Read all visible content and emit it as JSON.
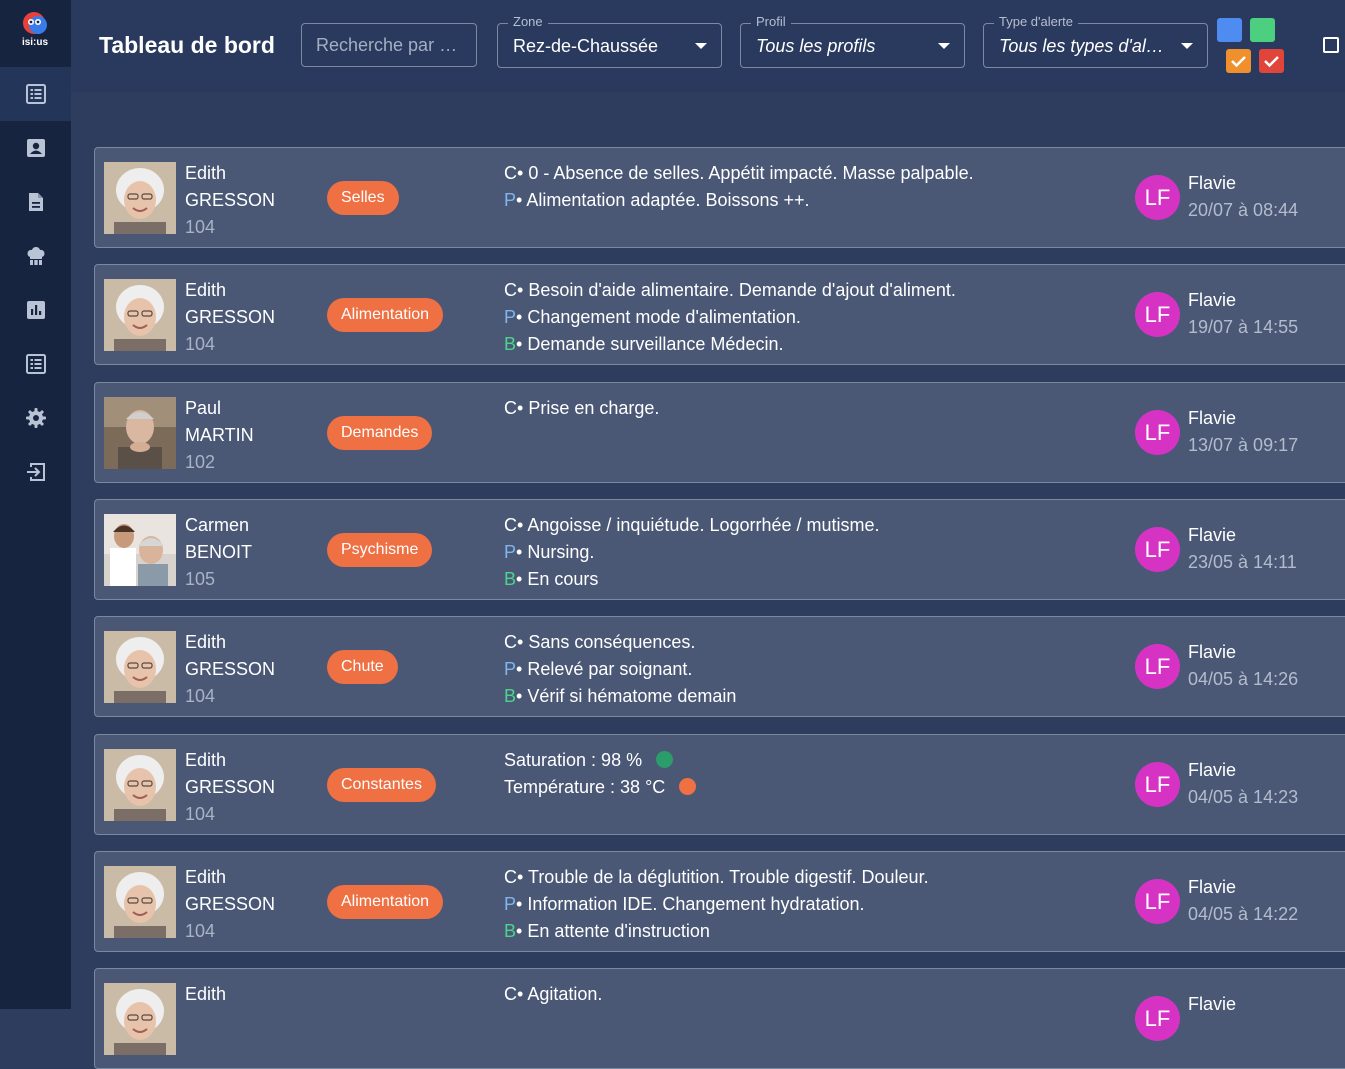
{
  "app": {
    "logo_text": "isi:us"
  },
  "header": {
    "title": "Tableau de bord",
    "search": {
      "placeholder": "Recherche par …",
      "value": ""
    },
    "zone": {
      "label": "Zone",
      "value": "Rez-de-Chaussée"
    },
    "profil": {
      "label": "Profil",
      "value": "Tous les profils"
    },
    "alert_type": {
      "label": "Type d'alerte",
      "value": "Tous les types d'al…"
    },
    "filter_colors": {
      "blue": "#4f8cf2",
      "green": "#4ccf7e",
      "orange": "#f0902c",
      "red": "#e1453a"
    }
  },
  "sidebar": {
    "items": [
      {
        "icon": "dashboard-list-icon",
        "active": true
      },
      {
        "icon": "resident-card-icon"
      },
      {
        "icon": "document-icon"
      },
      {
        "icon": "chef-hat-icon"
      },
      {
        "icon": "statistics-chart-icon"
      },
      {
        "icon": "list-icon"
      },
      {
        "icon": "settings-gear-icon"
      },
      {
        "icon": "logout-icon"
      }
    ]
  },
  "colors": {
    "tag": "#ee7043",
    "avatar": "#d633c5",
    "prefix_P": "#7fb6f0",
    "prefix_B": "#4cd48c",
    "dot_green": "#2a9d6a",
    "dot_orange": "#ee7043"
  },
  "alerts": [
    {
      "first_name": "Edith",
      "last_name": "GRESSON",
      "room": "104",
      "tag": "Selles",
      "lines": [
        {
          "prefix": "C",
          "sep": "•",
          "text": " 0 - Absence de selles. Appétit impacté. Masse palpable."
        },
        {
          "prefix": "P",
          "sep": "•",
          "text": " Alimentation adaptée. Boissons ++."
        }
      ],
      "author_initials": "LF",
      "author": "Flavie",
      "date": "20/07 à 08:44"
    },
    {
      "first_name": "Edith",
      "last_name": "GRESSON",
      "room": "104",
      "tag": "Alimentation",
      "lines": [
        {
          "prefix": "C",
          "sep": "•",
          "text": " Besoin d'aide alimentaire. Demande d'ajout d'aliment."
        },
        {
          "prefix": "P",
          "sep": "•",
          "text": " Changement mode d'alimentation."
        },
        {
          "prefix": "B",
          "sep": "•",
          "text": " Demande surveillance Médecin."
        }
      ],
      "author_initials": "LF",
      "author": "Flavie",
      "date": "19/07 à 14:55"
    },
    {
      "first_name": "Paul",
      "last_name": "MARTIN",
      "room": "102",
      "tag": "Demandes",
      "lines": [
        {
          "prefix": "C",
          "sep": "•",
          "text": " Prise en charge."
        }
      ],
      "author_initials": "LF",
      "author": "Flavie",
      "date": "13/07 à 09:17"
    },
    {
      "first_name": "Carmen",
      "last_name": "BENOIT",
      "room": "105",
      "tag": "Psychisme",
      "lines": [
        {
          "prefix": "C",
          "sep": "•",
          "text": " Angoisse / inquiétude. Logorrhée / mutisme."
        },
        {
          "prefix": "P",
          "sep": "•",
          "text": " Nursing."
        },
        {
          "prefix": "B",
          "sep": "•",
          "text": " En cours"
        }
      ],
      "author_initials": "LF",
      "author": "Flavie",
      "date": "23/05 à 14:11"
    },
    {
      "first_name": "Edith",
      "last_name": "GRESSON",
      "room": "104",
      "tag": "Chute",
      "lines": [
        {
          "prefix": "C",
          "sep": "•",
          "text": " Sans conséquences."
        },
        {
          "prefix": "P",
          "sep": "•",
          "text": " Relevé par soignant."
        },
        {
          "prefix": "B",
          "sep": "•",
          "text": " Vérif si hématome demain"
        }
      ],
      "author_initials": "LF",
      "author": "Flavie",
      "date": "04/05 à 14:26"
    },
    {
      "first_name": "Edith",
      "last_name": "GRESSON",
      "room": "104",
      "tag": "Constantes",
      "vitals": [
        {
          "text": "Saturation : 98 %",
          "status": "green"
        },
        {
          "text": "Température : 38 °C",
          "status": "orange"
        }
      ],
      "author_initials": "LF",
      "author": "Flavie",
      "date": "04/05 à 14:23"
    },
    {
      "first_name": "Edith",
      "last_name": "GRESSON",
      "room": "104",
      "tag": "Alimentation",
      "lines": [
        {
          "prefix": "C",
          "sep": "•",
          "text": " Trouble de la déglutition. Trouble digestif. Douleur."
        },
        {
          "prefix": "P",
          "sep": "•",
          "text": " Information IDE. Changement hydratation."
        },
        {
          "prefix": "B",
          "sep": "•",
          "text": " En attente d'instruction"
        }
      ],
      "author_initials": "LF",
      "author": "Flavie",
      "date": "04/05 à 14:22"
    },
    {
      "first_name": "Edith",
      "last_name": "",
      "room": "",
      "tag": "",
      "lines": [
        {
          "prefix": "C",
          "sep": "•",
          "text": " Agitation."
        }
      ],
      "author_initials": "LF",
      "author": "Flavie",
      "date": ""
    }
  ]
}
